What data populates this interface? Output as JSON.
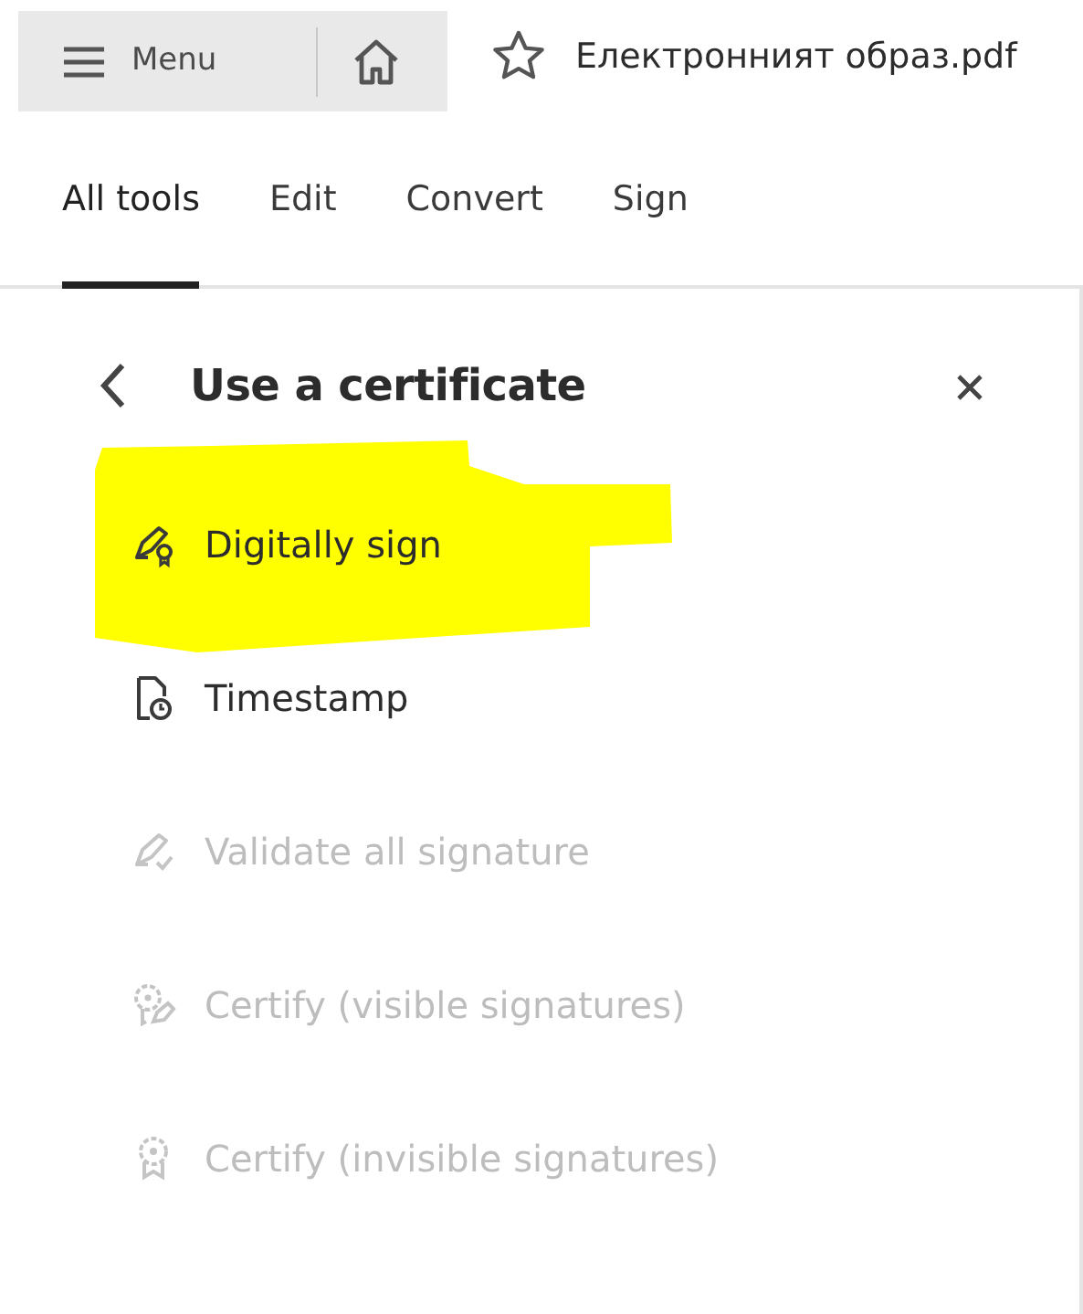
{
  "toolbar": {
    "menu_label": "Menu",
    "file_name": "Електронният образ.pdf"
  },
  "tabs": [
    {
      "label": "All tools",
      "selected": true
    },
    {
      "label": "Edit",
      "selected": false
    },
    {
      "label": "Convert",
      "selected": false
    },
    {
      "label": "Sign",
      "selected": false
    }
  ],
  "panel": {
    "title": "Use a certificate",
    "items": [
      {
        "label": "Digitally sign",
        "kind": "sign",
        "disabled": false,
        "highlighted": true
      },
      {
        "label": "Timestamp",
        "kind": "timestamp",
        "disabled": false,
        "highlighted": false
      },
      {
        "label": "Validate all signature",
        "kind": "validate",
        "disabled": true,
        "highlighted": false
      },
      {
        "label": "Certify (visible signatures)",
        "kind": "certify-visible",
        "disabled": true,
        "highlighted": false
      },
      {
        "label": "Certify (invisible signatures)",
        "kind": "certify-invisible",
        "disabled": true,
        "highlighted": false
      }
    ]
  }
}
